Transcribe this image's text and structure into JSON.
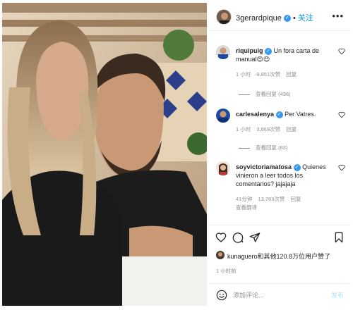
{
  "header": {
    "username": "3gerardpique",
    "separator": "•",
    "follow_label": "关注",
    "more_icon": "more-horizontal-icon",
    "verified_icon": "verified-badge-icon"
  },
  "comments": [
    {
      "username": "riquipuig",
      "text": "Un fora carta de manual😍😍",
      "time": "1 小时",
      "likes": "9,851次赞",
      "reply_label": "回复",
      "view_replies": "查看回复 (498)",
      "avatar_color": "#b9b9b9"
    },
    {
      "username": "carlesalenya",
      "text": "Per Vatres.",
      "time": "1 小时",
      "likes": "3,869次赞",
      "reply_label": "回复",
      "view_replies": "查看回复 (83)",
      "avatar_color": "#1d4aa3"
    },
    {
      "username": "soyvictoriamatosa",
      "text": "Quienes vinieron a leer todos los comentarios? jajajaja",
      "time": "41分钟",
      "likes": "13,783次赞",
      "reply_label": "回复",
      "view_translation": "查看翻译",
      "avatar_color": "#c23b3b"
    }
  ],
  "actions": {
    "like_icon": "heart-icon",
    "comment_icon": "comment-icon",
    "share_icon": "send-icon",
    "save_icon": "bookmark-icon"
  },
  "likes": {
    "text": "kunaguero和其他120.8万位用户赞了"
  },
  "time_ago": "1 小时前",
  "add_comment": {
    "placeholder": "添加评论...",
    "post_label": "发布",
    "emoji_icon": "emoji-icon",
    "post_color": "#b2dffc"
  },
  "colors": {
    "accent": "#0095f6",
    "verified": "#3897f0",
    "muted": "#8e8e8e"
  }
}
